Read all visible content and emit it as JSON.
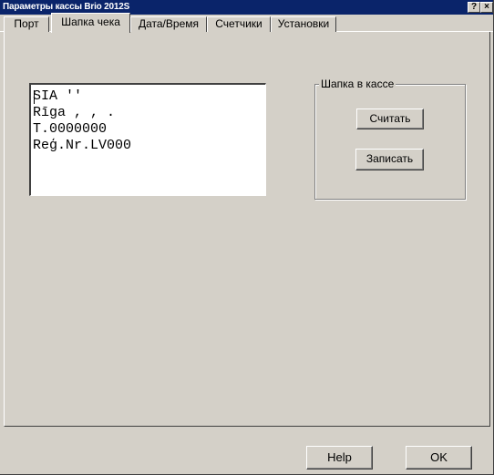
{
  "window": {
    "title": "Параметры кассы Brio 2012S",
    "help_glyph": "?",
    "close_glyph": "×"
  },
  "tabs": [
    {
      "label": "Порт",
      "active": false
    },
    {
      "label": "Шапка чека",
      "active": true
    },
    {
      "label": "Дата/Время",
      "active": false
    },
    {
      "label": "Счетчики",
      "active": false
    },
    {
      "label": "Установки",
      "active": false
    }
  ],
  "receipt_header": {
    "lines": [
      "SIA ''",
      "Rīga , , .",
      "T.0000000",
      "Reģ.Nr.LV000"
    ]
  },
  "register_group": {
    "legend": "Шапка в кассе",
    "read_label": "Считать",
    "write_label": "Записать"
  },
  "footer": {
    "help_label": "Help",
    "ok_label": "OK"
  },
  "colors": {
    "titlebar": "#0a246a",
    "face": "#d4d0c8"
  }
}
